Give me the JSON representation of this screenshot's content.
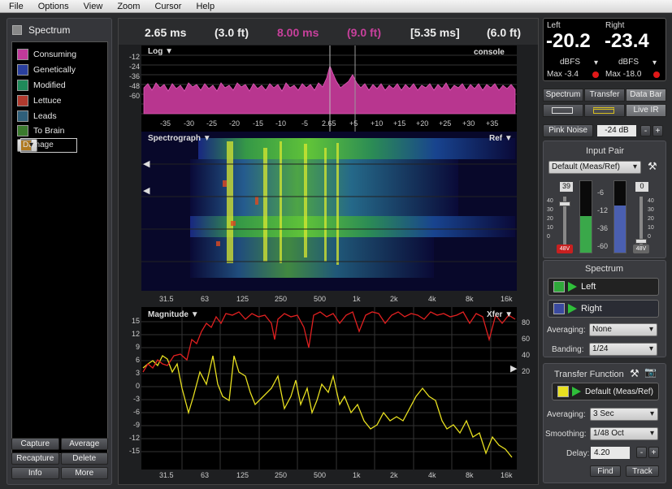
{
  "menu": [
    "File",
    "Options",
    "View",
    "Zoom",
    "Cursor",
    "Help"
  ],
  "left_panel": {
    "title": "Spectrum",
    "items": [
      {
        "label": "Consuming",
        "color": "#c03a9a"
      },
      {
        "label": "Genetically",
        "color": "#2a3f9e"
      },
      {
        "label": "Modified",
        "color": "#1f8a5a"
      },
      {
        "label": "Lettuce",
        "color": "#b03a2e"
      },
      {
        "label": "Leads",
        "color": "#2f5f7a"
      },
      {
        "label": "To Brain",
        "color": "#3a7a2e"
      },
      {
        "label": "Damage",
        "color": "#b07a20"
      }
    ],
    "buttons": [
      "Capture",
      "Average",
      "Recapture",
      "Delete",
      "Info",
      "More"
    ]
  },
  "databar": {
    "d1": "2.65 ms",
    "d1ft": "(3.0 ft)",
    "d2": "8.00 ms",
    "d2ft": "(9.0 ft)",
    "d3": "[5.35 ms]",
    "d3ft": "(6.0 ft)"
  },
  "log_pane": {
    "label": "Log ▼",
    "right_label": "console",
    "y_ticks": [
      "-12",
      "-24",
      "-36",
      "-48",
      "-60"
    ],
    "x_ticks": [
      "-35",
      "-30",
      "-25",
      "-20",
      "-15",
      "-10",
      "-5",
      "2.65",
      "+5",
      "+10",
      "+15",
      "+20",
      "+25",
      "+30",
      "+35"
    ]
  },
  "spectro_pane": {
    "label": "Spectrograph ▼",
    "right_label": "Ref ▼",
    "x_ticks": [
      "31.5",
      "63",
      "125",
      "250",
      "500",
      "1k",
      "2k",
      "4k",
      "8k",
      "16k"
    ]
  },
  "mag_pane": {
    "label": "Magnitude ▼",
    "right_label": "Xfer ▼",
    "y_ticks": [
      "15",
      "12",
      "9",
      "6",
      "3",
      "0",
      "-3",
      "-6",
      "-9",
      "-12",
      "-15"
    ],
    "y2_ticks": [
      "80",
      "60",
      "40",
      "20"
    ],
    "x_ticks": [
      "31.5",
      "63",
      "125",
      "250",
      "500",
      "1k",
      "2k",
      "4k",
      "8k",
      "16k"
    ]
  },
  "meters": {
    "left_label": "Left",
    "right_label": "Right",
    "left_value": "-20.2",
    "right_value": "-23.4",
    "unit": "dBFS",
    "left_max": "Max  -3.4",
    "right_max": "Max  -18.0"
  },
  "tabs": [
    "Spectrum",
    "Transfer",
    "Data Bar"
  ],
  "live_ir": "Live IR",
  "pink_noise": {
    "label": "Pink Noise",
    "value": "-24 dB",
    "minus": "-",
    "plus": "+"
  },
  "input_pair": {
    "title": "Input Pair",
    "selected": "Default (Meas/Ref)",
    "gain_left": "39",
    "gain_right": "0",
    "scale": [
      "40",
      "30",
      "20",
      "10",
      "0"
    ],
    "meter_ticks": [
      "-6",
      "-12",
      "-36",
      "-60"
    ],
    "phantom": "48V"
  },
  "spectrum_section": {
    "title": "Spectrum",
    "ch1": "Left",
    "ch2": "Right",
    "averaging_label": "Averaging:",
    "averaging": "None",
    "banding_label": "Banding:",
    "banding": "1/24"
  },
  "transfer_section": {
    "title": "Transfer Function",
    "pair": "Default (Meas/Ref)",
    "averaging_label": "Averaging:",
    "averaging": "3 Sec",
    "smoothing_label": "Smoothing:",
    "smoothing": "1/48 Oct",
    "delay_label": "Delay:",
    "delay": "4.20",
    "find": "Find",
    "track": "Track"
  },
  "colors": {
    "magenta": "#c8409c",
    "red": "#e02020",
    "yellow": "#e8e020",
    "green": "#2fbf3a"
  }
}
